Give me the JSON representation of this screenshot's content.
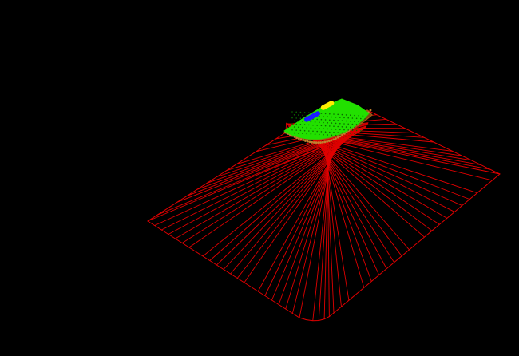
{
  "scene": {
    "background_color": "#000000",
    "mesh": {
      "wire_color": "#e00000",
      "radial_line_count": 72
    },
    "fill_region": {
      "color": "#22e000",
      "point_color": "#0a6a00"
    },
    "boundary_band": {
      "color": "#7a4a10"
    },
    "markers": [
      {
        "name": "blue-marker",
        "color": "#1a1aff"
      },
      {
        "name": "yellow-marker",
        "color": "#ffee00"
      }
    ]
  }
}
